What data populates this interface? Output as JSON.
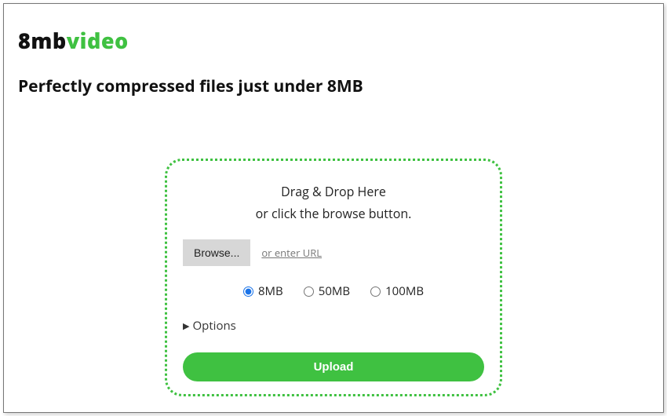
{
  "logo": {
    "part1": "8mb",
    "part2": "video"
  },
  "tagline": "Perfectly compressed files just under 8MB",
  "dropzone": {
    "line1": "Drag & Drop Here",
    "line2": "or click the browse button.",
    "browse_label": "Browse...",
    "enter_url_label": "or enter URL",
    "options_label": "Options",
    "upload_label": "Upload"
  },
  "sizes": {
    "options": [
      {
        "label": "8MB",
        "selected": true
      },
      {
        "label": "50MB",
        "selected": false
      },
      {
        "label": "100MB",
        "selected": false
      }
    ]
  },
  "colors": {
    "brand_green": "#3fc141"
  }
}
